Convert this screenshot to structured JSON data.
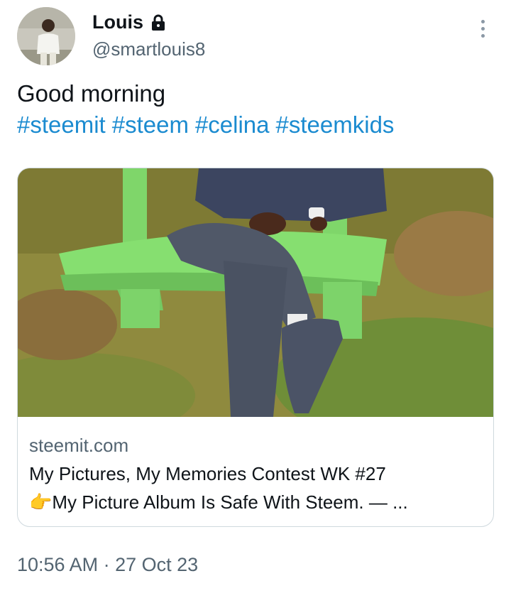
{
  "author": {
    "name": "Louis",
    "handle": "@smartlouis8",
    "lock_icon": "lock-icon",
    "avatar_icon": "profile-photo"
  },
  "more_icon": "more-vertical-icon",
  "tweet": {
    "text": "Good morning",
    "hashtags": [
      "#steemit",
      "#steem",
      "#celina",
      "#steemkids"
    ]
  },
  "card": {
    "image_icon": "photo-man-sitting-on-green-bench",
    "domain": "steemit.com",
    "title_line1": "My Pictures, My Memories Contest WK #27",
    "title_line2": "👉My Picture Album Is Safe With Steem. — ..."
  },
  "meta": {
    "time": "10:56 AM",
    "separator": " · ",
    "date": "27 Oct 23"
  },
  "colors": {
    "link": "#1b8bd0",
    "secondary_text": "#536471",
    "primary_text": "#0f1419",
    "card_border": "#cfd9de"
  }
}
